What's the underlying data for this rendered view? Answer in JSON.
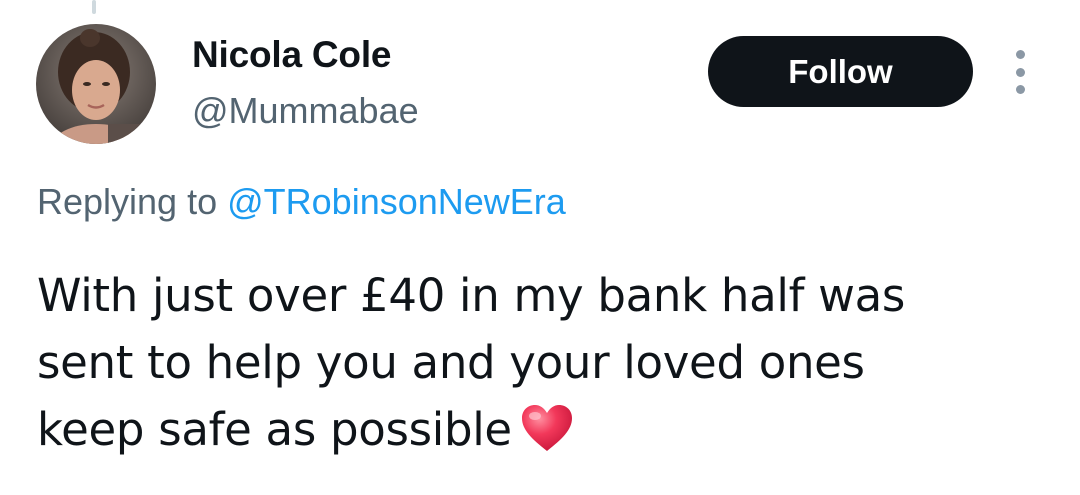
{
  "tweet": {
    "author": {
      "display_name": "Nicola Cole",
      "handle": "@Mummabae",
      "avatar": "profile-photo"
    },
    "follow_label": "Follow",
    "more_icon": "more-vertical-icon",
    "reply": {
      "prefix": "Replying to",
      "mention": "@TRobinsonNewEra"
    },
    "text_lines": [
      "With just over £40 in my bank half was",
      "sent to help you and your loved ones",
      "keep safe as possible"
    ],
    "emoji": "red-heart-icon",
    "colors": {
      "text": "#0f1419",
      "secondary": "#536471",
      "link": "#1d9bf0",
      "follow_bg": "#0f1419",
      "heart": "#f2385a"
    }
  }
}
